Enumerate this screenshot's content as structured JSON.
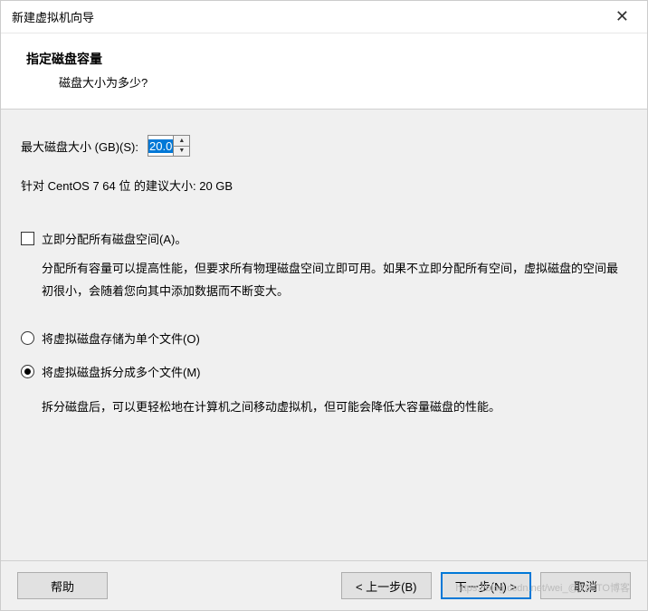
{
  "titlebar": {
    "title": "新建虚拟机向导"
  },
  "header": {
    "title": "指定磁盘容量",
    "subtitle": "磁盘大小为多少?"
  },
  "diskSize": {
    "label": "最大磁盘大小 (GB)(S):",
    "value": "20.0"
  },
  "recommend": {
    "text": "针对 CentOS 7 64 位 的建议大小: 20 GB"
  },
  "allocateNow": {
    "label": "立即分配所有磁盘空间(A)。",
    "description": "分配所有容量可以提高性能，但要求所有物理磁盘空间立即可用。如果不立即分配所有空间，虚拟磁盘的空间最初很小，会随着您向其中添加数据而不断变大。"
  },
  "singleFile": {
    "label": "将虚拟磁盘存储为单个文件(O)"
  },
  "splitFiles": {
    "label": "将虚拟磁盘拆分成多个文件(M)",
    "description": "拆分磁盘后，可以更轻松地在计算机之间移动虚拟机，但可能会降低大容量磁盘的性能。"
  },
  "buttons": {
    "help": "帮助",
    "back": "< 上一步(B)",
    "next": "下一步(N) >",
    "cancel": "取消"
  },
  "watermark": "https://blog.csdn.net/wei_@51CTO博客"
}
